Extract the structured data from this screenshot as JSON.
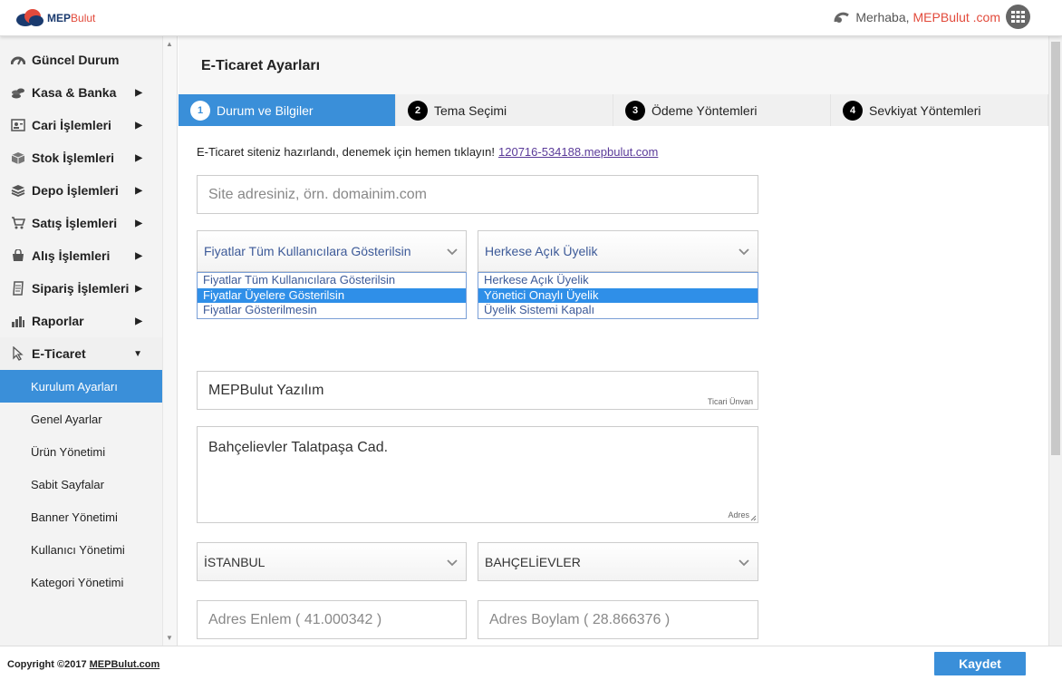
{
  "header": {
    "logo_main": "MEP",
    "logo_sub": "Bulut",
    "greeting": "Merhaba,",
    "brand": "MEPBulut .com",
    "apps_icon": "grid-icon"
  },
  "sidebar": {
    "items": [
      {
        "label": "Güncel Durum",
        "icon": "gauge-icon",
        "arrow": ""
      },
      {
        "label": "Kasa & Banka",
        "icon": "coins-icon",
        "arrow": "▶"
      },
      {
        "label": "Cari İşlemleri",
        "icon": "contact-card-icon",
        "arrow": "▶"
      },
      {
        "label": "Stok İşlemleri",
        "icon": "box-icon",
        "arrow": "▶"
      },
      {
        "label": "Depo İşlemleri",
        "icon": "stack-icon",
        "arrow": "▶"
      },
      {
        "label": "Satış İşlemleri",
        "icon": "cart-icon",
        "arrow": "▶"
      },
      {
        "label": "Alış İşlemleri",
        "icon": "bag-icon",
        "arrow": "▶"
      },
      {
        "label": "Sipariş İşlemleri",
        "icon": "receipt-icon",
        "arrow": "▶"
      },
      {
        "label": "Raporlar",
        "icon": "bar-chart-icon",
        "arrow": "▶"
      },
      {
        "label": "E-Ticaret",
        "icon": "cursor-icon",
        "arrow": "▼"
      }
    ],
    "subitems": [
      "Kurulum Ayarları",
      "Genel Ayarlar",
      "Ürün Yönetimi",
      "Sabit Sayfalar",
      "Banner Yönetimi",
      "Kullanıcı Yönetimi",
      "Kategori Yönetimi"
    ]
  },
  "page": {
    "title": "E-Ticaret Ayarları",
    "tabs": [
      {
        "num": "1",
        "label": "Durum ve Bilgiler"
      },
      {
        "num": "2",
        "label": "Tema Seçimi"
      },
      {
        "num": "3",
        "label": "Ödeme Yöntemleri"
      },
      {
        "num": "4",
        "label": "Sevkiyat Yöntemleri"
      }
    ],
    "notice": "E-Ticaret siteniz hazırlandı, denemek için hemen tıklayın!",
    "notice_link": "120716-534188.mepbulut.com",
    "site_placeholder": "Site adresiniz, örn. domainim.com",
    "price_select": {
      "value": "Fiyatlar Tüm Kullanıcılara Gösterilsin",
      "options": [
        "Fiyatlar Tüm Kullanıcılara Gösterilsin",
        "Fiyatlar Üyelere Gösterilsin",
        "Fiyatlar Gösterilmesin"
      ]
    },
    "member_select": {
      "value": "Herkese Açık Üyelik",
      "options": [
        "Herkese Açık Üyelik",
        "Yönetici Onaylı Üyelik",
        "Üyelik Sistemi Kapalı"
      ]
    },
    "company_value": "MEPBulut Yazılım",
    "company_tag": "Ticari Ünvan",
    "address_value": "Bahçelievler Talatpaşa Cad.",
    "address_tag": "Adres",
    "city": "İSTANBUL",
    "district": "BAHÇELİEVLER",
    "lat_placeholder": "Adres Enlem ( 41.000342 )",
    "lng_placeholder": "Adres Boylam ( 28.866376 )"
  },
  "footer": {
    "copyright": "Copyright ©2017",
    "copyright_link": "MEPBulut.com",
    "save_label": "Kaydet"
  },
  "colors": {
    "accent": "#3a8fd9",
    "brand_red": "#e24a3b",
    "selected_option": "#2f8fe8"
  }
}
